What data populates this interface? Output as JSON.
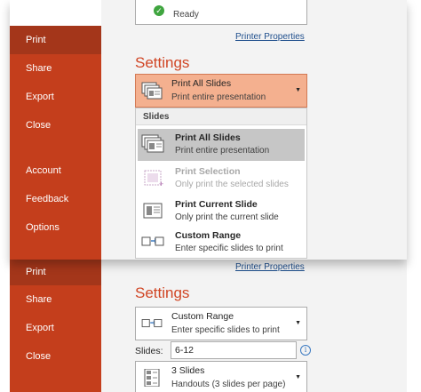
{
  "top": {
    "printer_status": "Ready",
    "printer_properties": "Printer Properties",
    "nav": [
      "Print",
      "Share",
      "Export",
      "Close",
      "Account",
      "Feedback",
      "Options"
    ],
    "settings_heading": "Settings",
    "dropdown": {
      "title": "Print All Slides",
      "subtitle": "Print entire presentation"
    },
    "menu": {
      "header": "Slides",
      "items": [
        {
          "title": "Print All Slides",
          "subtitle": "Print entire presentation",
          "state": "selected"
        },
        {
          "title": "Print Selection",
          "subtitle": "Only print the selected slides",
          "state": "disabled"
        },
        {
          "title": "Print Current Slide",
          "subtitle": "Only print the current slide",
          "state": "normal"
        },
        {
          "title": "Custom Range",
          "subtitle": "Enter specific slides to print",
          "state": "normal"
        }
      ]
    }
  },
  "bottom": {
    "printer_properties": "Printer Properties",
    "nav": [
      "Print",
      "Share",
      "Export",
      "Close"
    ],
    "settings_heading": "Settings",
    "dropdown": {
      "title": "Custom Range",
      "subtitle": "Enter specific slides to print"
    },
    "slides_label": "Slides:",
    "slides_value": "6-12",
    "layout_dropdown": {
      "title": "3 Slides",
      "subtitle": "Handouts (3 slides per page)"
    }
  },
  "colors": {
    "sidebar": "#c43e1c",
    "active_nav": "#a4361a",
    "accent": "#d04524",
    "link": "#1e4e8c"
  }
}
